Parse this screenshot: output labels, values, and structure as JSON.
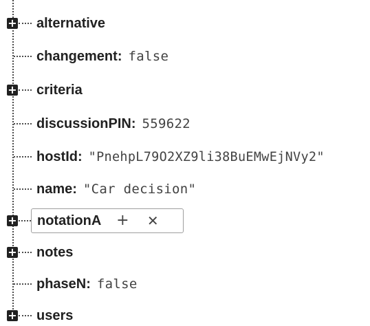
{
  "tree": {
    "expand_symbol": "+",
    "nodes": [
      {
        "key": "alternative",
        "expandable": true
      },
      {
        "key": "changement",
        "colon": ":",
        "value": "false"
      },
      {
        "key": "criteria",
        "expandable": true
      },
      {
        "key": "discussionPIN",
        "colon": ":",
        "value": "559622"
      },
      {
        "key": "hostId",
        "colon": ":",
        "value": "\"PnehpL79O2XZ9li38BuEMwEjNVy2\""
      },
      {
        "key": "name",
        "colon": ":",
        "value": "\"Car decision\""
      },
      {
        "key": "notationA",
        "expandable": true,
        "hovered": true
      },
      {
        "key": "notes",
        "expandable": true
      },
      {
        "key": "phaseN",
        "colon": ":",
        "value": "false"
      },
      {
        "key": "users",
        "expandable": true
      }
    ],
    "hover_actions": {
      "add_label": "+",
      "remove_label": "✕"
    }
  }
}
